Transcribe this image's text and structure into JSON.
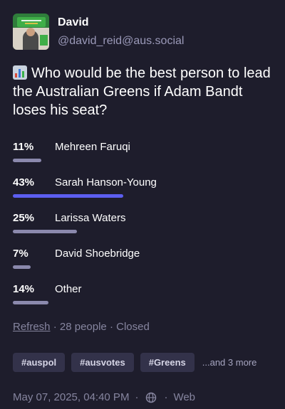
{
  "author": {
    "display_name": "David",
    "handle": "@david_reid@aus.social"
  },
  "poll": {
    "question_icon": "bar-chart-emoji-icon",
    "question": "Who would be the best person to lead the Australian Greens if Adam Bandt loses his seat?",
    "options": [
      {
        "percent_label": "11%",
        "label": "Mehreen Faruqi",
        "percent": 11,
        "leading": false
      },
      {
        "percent_label": "43%",
        "label": "Sarah Hanson-Young",
        "percent": 43,
        "leading": true
      },
      {
        "percent_label": "25%",
        "label": "Larissa Waters",
        "percent": 25,
        "leading": false
      },
      {
        "percent_label": "7%",
        "label": "David Shoebridge",
        "percent": 7,
        "leading": false
      },
      {
        "percent_label": "14%",
        "label": "Other",
        "percent": 14,
        "leading": false
      }
    ],
    "refresh_label": "Refresh",
    "voters_text": "28 people",
    "status_text": "Closed",
    "separator": "·"
  },
  "hashtags": [
    "#auspol",
    "#ausvotes",
    "#Greens"
  ],
  "more_tags_text": "...and 3 more",
  "footer": {
    "timestamp": "May 07, 2025, 04:40 PM",
    "visibility_icon": "globe-icon",
    "client": "Web",
    "separator": "·"
  },
  "colors": {
    "background": "#1e1d2c",
    "leading_bar": "#5c5ef0",
    "other_bar": "#8b89ad",
    "muted_text": "#86859f",
    "tag_background": "#33324a"
  }
}
